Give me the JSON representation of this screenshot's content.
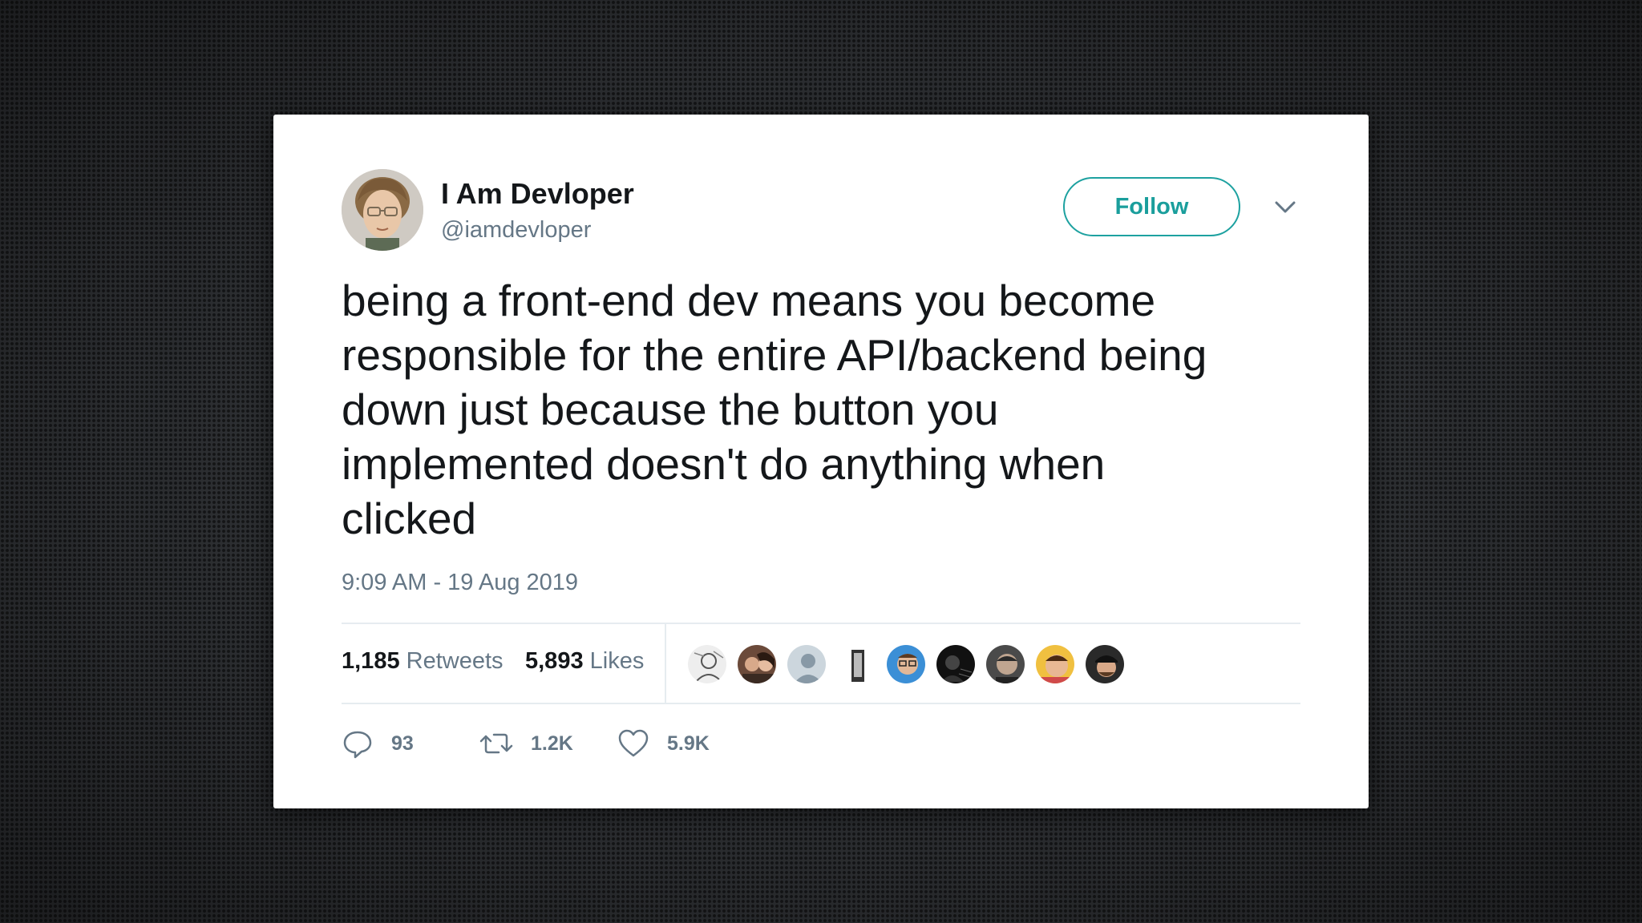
{
  "tweet": {
    "author": {
      "name": "I Am Devloper",
      "handle": "@iamdevloper"
    },
    "follow_label": "Follow",
    "text_lines": [
      "being a front-end dev means you become",
      "responsible for the entire API/backend being",
      "down just because the button you",
      "implemented doesn't do anything when",
      "clicked"
    ],
    "timestamp": "9:09 AM - 19 Aug 2019",
    "stats": {
      "retweets_count": "1,185",
      "retweets_label": "Retweets",
      "likes_count": "5,893",
      "likes_label": "Likes"
    },
    "actions": {
      "replies": "93",
      "retweets": "1.2K",
      "likes": "5.9K"
    },
    "likers": [
      {
        "icon": "avatar-sketch"
      },
      {
        "icon": "avatar-couple"
      },
      {
        "icon": "avatar-default"
      },
      {
        "icon": "avatar-figure"
      },
      {
        "icon": "avatar-glasses"
      },
      {
        "icon": "avatar-dark"
      },
      {
        "icon": "avatar-man"
      },
      {
        "icon": "avatar-colorful"
      },
      {
        "icon": "avatar-cap"
      }
    ],
    "colors": {
      "accent": "#1da1a0",
      "text": "#14171a",
      "muted": "#657786"
    }
  }
}
